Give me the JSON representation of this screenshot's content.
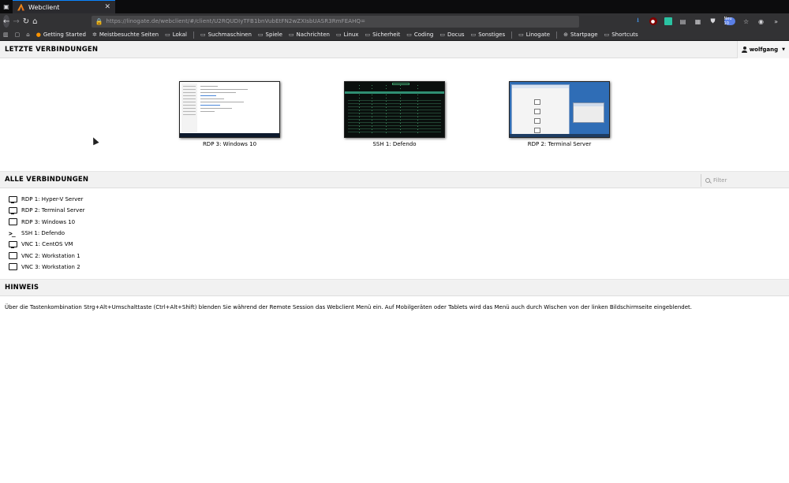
{
  "browser": {
    "tab_list_icon": "tab-list-icon",
    "tab": {
      "title": "Webclient",
      "close_icon": "close-icon"
    },
    "url": "https://linogate.de/webclient/#/client/U2RQUDIyTFB1bnVubEtFN2wZXIsbUASR3RmFEAHQ=",
    "bookmarks": [
      {
        "label": "",
        "icon": "bookmarks-icon"
      },
      {
        "label": "",
        "icon": "screenshot-icon"
      },
      {
        "label": "",
        "icon": "home-icon"
      },
      {
        "label": "Getting Started",
        "icon": "firefox-icon"
      },
      {
        "label": "Meistbesuchte Seiten",
        "icon": "gear-icon"
      },
      {
        "label": "Lokal",
        "icon": "folder-icon"
      },
      {
        "label": "Suchmaschinen",
        "icon": "folder-icon"
      },
      {
        "label": "Spiele",
        "icon": "folder-icon"
      },
      {
        "label": "Nachrichten",
        "icon": "folder-icon"
      },
      {
        "label": "Linux",
        "icon": "folder-icon"
      },
      {
        "label": "Sicherheit",
        "icon": "folder-icon"
      },
      {
        "label": "Coding",
        "icon": "folder-icon"
      },
      {
        "label": "Docus",
        "icon": "folder-icon"
      },
      {
        "label": "Sonstiges",
        "icon": "folder-icon"
      },
      {
        "label": "Linogate",
        "icon": "folder-icon"
      },
      {
        "label": "Startpage",
        "icon": "globe-icon"
      },
      {
        "label": "Shortcuts",
        "icon": "folder-icon"
      }
    ],
    "toolbar_badge": "Neu 10"
  },
  "page": {
    "recent": {
      "title": "LETZTE VERBINDUNGEN",
      "user": "wolfgang",
      "thumbnails": [
        {
          "label": "RDP 3: Windows 10",
          "type": "windows"
        },
        {
          "label": "SSH 1: Defendo",
          "type": "terminal"
        },
        {
          "label": "RDP 2: Terminal Server",
          "type": "server"
        }
      ]
    },
    "all": {
      "title": "ALLE VERBINDUNGEN",
      "filter_placeholder": "Filter",
      "connections": [
        {
          "label": "RDP 1: Hyper-V Server",
          "icon": "monitor-icon"
        },
        {
          "label": "RDP 2: Terminal Server",
          "icon": "monitor-icon"
        },
        {
          "label": "RDP 3: Windows 10",
          "icon": "monitor-icon"
        },
        {
          "label": "SSH 1: Defendo",
          "icon": "terminal-icon"
        },
        {
          "label": "VNC 1: CentOS VM",
          "icon": "monitor-icon"
        },
        {
          "label": "VNC 2: Workstation 1",
          "icon": "monitor-icon"
        },
        {
          "label": "VNC 3: Workstation 2",
          "icon": "monitor-icon"
        }
      ]
    },
    "hint": {
      "title": "HINWEIS",
      "text": "Über die Tastenkombination Strg+Alt+Umschalttaste (Ctrl+Alt+Shift) blenden Sie während der Remote Session das Webclient Menü ein. Auf Mobilgeräten oder Tablets wird das Menü auch durch Wischen von der linken Bildschirmseite eingeblendet."
    }
  },
  "colors": {
    "chrome_dark": "#0c0c0d",
    "toolbar": "#323234",
    "section_header": "#f1f1f1",
    "accent": "#0a84ff"
  }
}
